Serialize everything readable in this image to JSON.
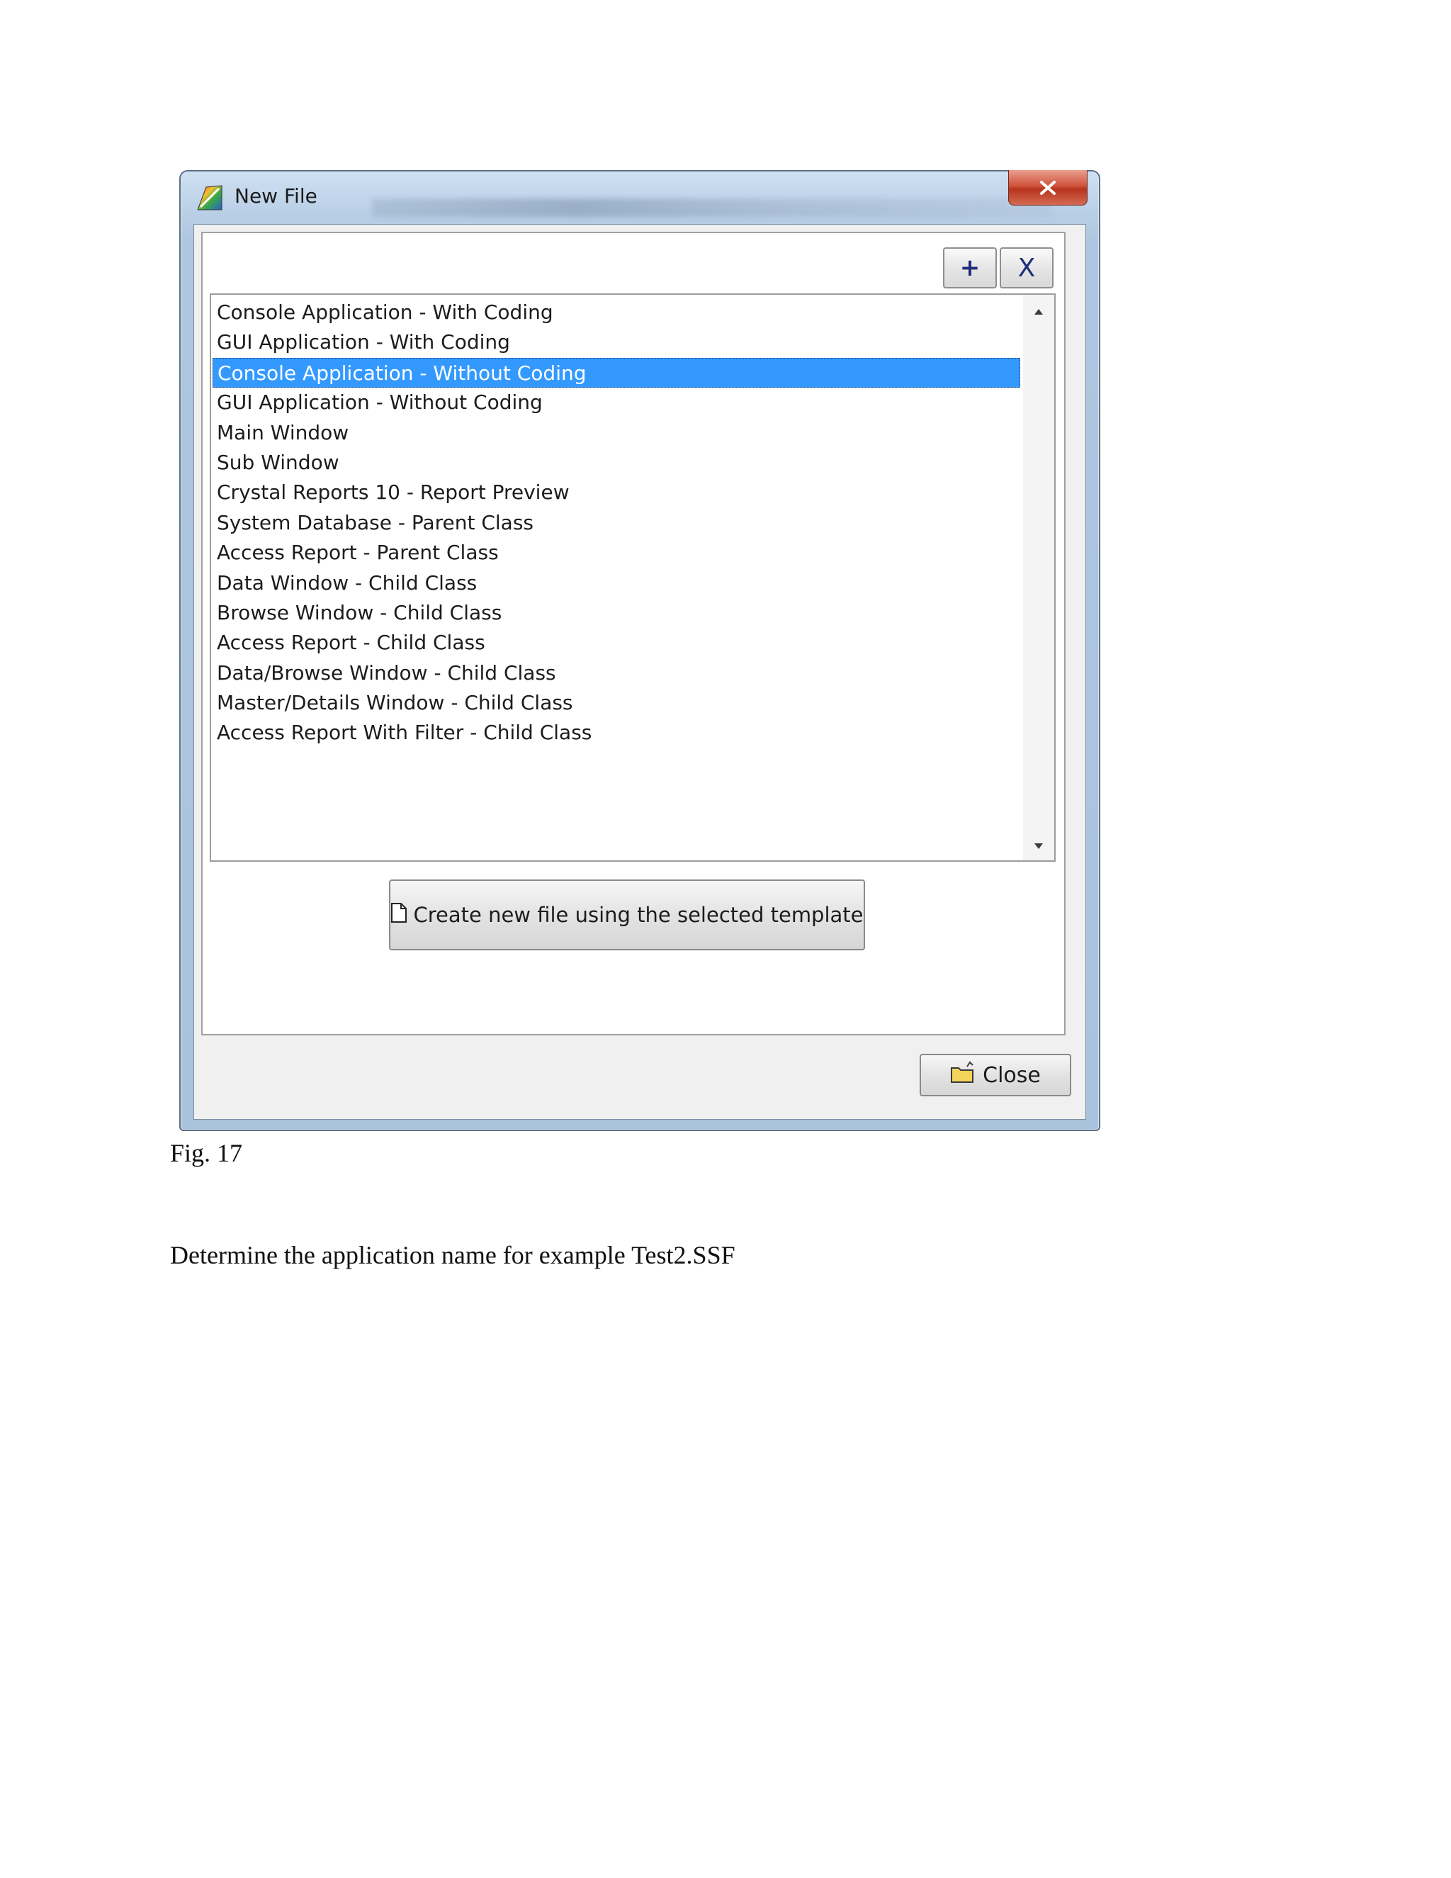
{
  "window": {
    "title": "New File",
    "close_glyph": "✕"
  },
  "toolbar": {
    "add_label": "+",
    "delete_label": "X"
  },
  "templates": {
    "items": [
      "Console Application - With Coding",
      "GUI Application - With Coding",
      "Console Application - Without Coding",
      "GUI Application - Without Coding",
      "Main Window",
      "Sub Window",
      "Crystal Reports 10 - Report Preview",
      "System Database - Parent Class",
      "Access Report - Parent Class",
      "Data Window - Child Class",
      "Browse Window - Child Class",
      "Access Report - Child Class",
      "Data/Browse Window - Child Class",
      "Master/Details Window - Child Class",
      "Access Report With Filter - Child Class"
    ],
    "selected_index": 2
  },
  "actions": {
    "create_label": "Create new file using the selected template",
    "close_label": "Close"
  },
  "document": {
    "caption": "Fig. 17",
    "paragraph": "Determine the application name for example Test2.SSF"
  },
  "colors": {
    "selection": "#3399ff",
    "close_button": "#c8432c",
    "window_frame": "#aec6df"
  },
  "icons": {
    "app": "app-palette-icon",
    "create": "document-icon",
    "close": "folder-close-icon",
    "scroll_up": "arrow-up-icon",
    "scroll_down": "arrow-down-icon"
  }
}
